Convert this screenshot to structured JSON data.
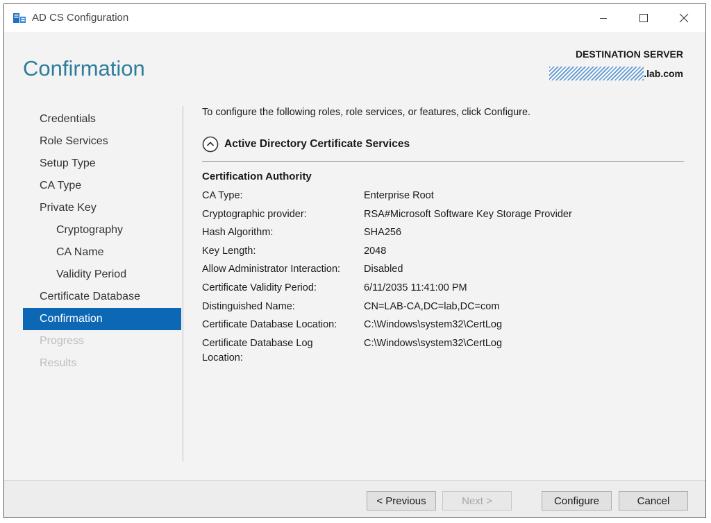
{
  "window": {
    "title": "AD CS Configuration",
    "controls": {
      "minimize": "minimize",
      "maximize": "maximize",
      "close": "close"
    }
  },
  "header": {
    "page_title": "Confirmation",
    "destination_label": "DESTINATION SERVER",
    "destination_server_suffix": ".lab.com"
  },
  "sidebar": {
    "items": [
      {
        "label": "Credentials",
        "level": 0,
        "state": "normal"
      },
      {
        "label": "Role Services",
        "level": 0,
        "state": "normal"
      },
      {
        "label": "Setup Type",
        "level": 0,
        "state": "normal"
      },
      {
        "label": "CA Type",
        "level": 0,
        "state": "normal"
      },
      {
        "label": "Private Key",
        "level": 0,
        "state": "normal"
      },
      {
        "label": "Cryptography",
        "level": 1,
        "state": "normal"
      },
      {
        "label": "CA Name",
        "level": 1,
        "state": "normal"
      },
      {
        "label": "Validity Period",
        "level": 1,
        "state": "normal"
      },
      {
        "label": "Certificate Database",
        "level": 0,
        "state": "normal"
      },
      {
        "label": "Confirmation",
        "level": 0,
        "state": "active"
      },
      {
        "label": "Progress",
        "level": 0,
        "state": "disabled"
      },
      {
        "label": "Results",
        "level": 0,
        "state": "disabled"
      }
    ]
  },
  "content": {
    "intro": "To configure the following roles, role services, or features, click Configure.",
    "section_title": "Active Directory Certificate Services",
    "subsection_title": "Certification Authority",
    "properties": [
      {
        "label": "CA Type:",
        "value": "Enterprise Root"
      },
      {
        "label": "Cryptographic provider:",
        "value": "RSA#Microsoft Software Key Storage Provider"
      },
      {
        "label": "Hash Algorithm:",
        "value": "SHA256"
      },
      {
        "label": "Key Length:",
        "value": "2048"
      },
      {
        "label": "Allow Administrator Interaction:",
        "value": "Disabled"
      },
      {
        "label": "Certificate Validity Period:",
        "value": "6/11/2035 11:41:00 PM"
      },
      {
        "label": "Distinguished Name:",
        "value": "CN=LAB-CA,DC=lab,DC=com"
      },
      {
        "label": "Certificate Database Location:",
        "value": "C:\\Windows\\system32\\CertLog"
      },
      {
        "label": "Certificate Database Log Location:",
        "value": "C:\\Windows\\system32\\CertLog"
      }
    ]
  },
  "footer": {
    "previous": "< Previous",
    "next": "Next >",
    "configure": "Configure",
    "cancel": "Cancel"
  },
  "colors": {
    "heading": "#2f7d9c",
    "active_nav": "#0c67b5",
    "redaction": "#6f9fd0"
  },
  "icons": {
    "app": "server-manager-icon",
    "collapse": "chevron-up-circle-icon"
  }
}
